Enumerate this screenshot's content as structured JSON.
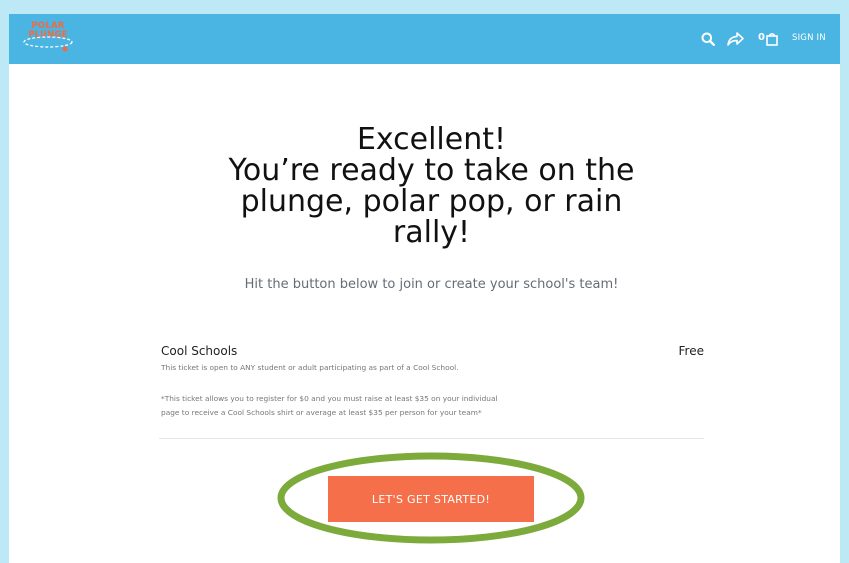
{
  "header": {
    "logo_text": [
      "POLAR",
      "PLUNGE"
    ],
    "cart_count": "0",
    "signin_label": "SIGN IN",
    "icons": [
      "search-icon",
      "share-icon",
      "cart-icon"
    ]
  },
  "main": {
    "headline_lines": [
      "Excellent!",
      "You’re ready to take on the",
      "plunge, polar pop, or rain",
      "rally!"
    ],
    "subheadline": "Hit the button below to join or create your school's team!"
  },
  "ticket": {
    "name": "Cool Schools",
    "price": "Free",
    "description": "This ticket is open to ANY student or adult participating as part of a Cool School.",
    "note_lines": [
      "*This ticket allows you to register for $0 and you must raise at least $35 on your individual",
      "page to receive a Cool Schools shirt or average at least $35 per person for your team*"
    ]
  },
  "cta": {
    "label": "LET'S GET STARTED!"
  },
  "colors": {
    "page_bg": "#bde9f6",
    "header_bg": "#4ab5e3",
    "button_bg": "#f5704a",
    "highlight_ring": "#7cab3c",
    "logo": "#f26a3d"
  }
}
